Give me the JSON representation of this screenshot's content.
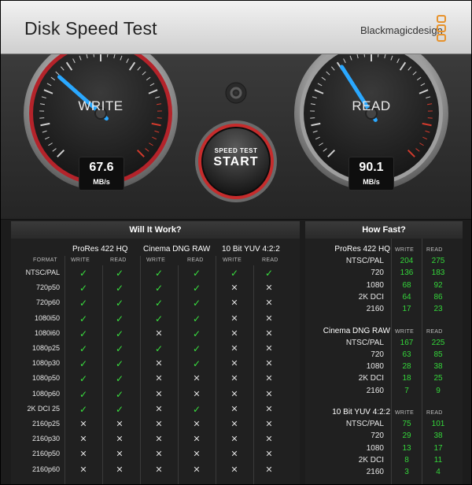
{
  "app": {
    "title": "Disk Speed Test",
    "brand": "Blackmagicdesign",
    "brand_color": "#e7922b"
  },
  "gauges": {
    "write": {
      "label": "WRITE",
      "value": "67.6",
      "unit": "MB/s",
      "needle_fraction": 0.32
    },
    "read": {
      "label": "READ",
      "value": "90.1",
      "unit": "MB/s",
      "needle_fraction": 0.38
    },
    "start_button": {
      "top": "SPEED TEST",
      "main": "START"
    },
    "settings_icon": "gear-icon",
    "needle_color": "#2aa8ff",
    "ring_color": "#c0282a"
  },
  "will_it_work": {
    "title": "Will It Work?",
    "groups": [
      "ProRes 422 HQ",
      "Cinema DNG RAW",
      "10 Bit YUV 4:2:2"
    ],
    "subheads": [
      "FORMAT",
      "WRITE",
      "READ"
    ],
    "rows": [
      {
        "format": "NTSC/PAL",
        "marks": [
          true,
          true,
          true,
          true,
          true,
          true
        ]
      },
      {
        "format": "720p50",
        "marks": [
          true,
          true,
          true,
          true,
          false,
          false
        ]
      },
      {
        "format": "720p60",
        "marks": [
          true,
          true,
          true,
          true,
          false,
          false
        ]
      },
      {
        "format": "1080i50",
        "marks": [
          true,
          true,
          true,
          true,
          false,
          false
        ]
      },
      {
        "format": "1080i60",
        "marks": [
          true,
          true,
          false,
          true,
          false,
          false
        ]
      },
      {
        "format": "1080p25",
        "marks": [
          true,
          true,
          true,
          true,
          false,
          false
        ]
      },
      {
        "format": "1080p30",
        "marks": [
          true,
          true,
          false,
          true,
          false,
          false
        ]
      },
      {
        "format": "1080p50",
        "marks": [
          true,
          true,
          false,
          false,
          false,
          false
        ]
      },
      {
        "format": "1080p60",
        "marks": [
          true,
          true,
          false,
          false,
          false,
          false
        ]
      },
      {
        "format": "2K DCI 25",
        "marks": [
          true,
          true,
          false,
          true,
          false,
          false
        ]
      },
      {
        "format": "2160p25",
        "marks": [
          false,
          false,
          false,
          false,
          false,
          false
        ]
      },
      {
        "format": "2160p30",
        "marks": [
          false,
          false,
          false,
          false,
          false,
          false
        ]
      },
      {
        "format": "2160p50",
        "marks": [
          false,
          false,
          false,
          false,
          false,
          false
        ]
      },
      {
        "format": "2160p60",
        "marks": [
          false,
          false,
          false,
          false,
          false,
          false
        ]
      }
    ],
    "check_color": "#39e03f",
    "cross_color": "#dddddd"
  },
  "how_fast": {
    "title": "How Fast?",
    "subheads": [
      "WRITE",
      "READ"
    ],
    "sections": [
      {
        "name": "ProRes 422 HQ",
        "rows": [
          {
            "format": "NTSC/PAL",
            "write": "204",
            "read": "275"
          },
          {
            "format": "720",
            "write": "136",
            "read": "183"
          },
          {
            "format": "1080",
            "write": "68",
            "read": "92"
          },
          {
            "format": "2K DCI",
            "write": "64",
            "read": "86"
          },
          {
            "format": "2160",
            "write": "17",
            "read": "23"
          }
        ]
      },
      {
        "name": "Cinema DNG RAW",
        "rows": [
          {
            "format": "NTSC/PAL",
            "write": "167",
            "read": "225"
          },
          {
            "format": "720",
            "write": "63",
            "read": "85"
          },
          {
            "format": "1080",
            "write": "28",
            "read": "38"
          },
          {
            "format": "2K DCI",
            "write": "18",
            "read": "25"
          },
          {
            "format": "2160",
            "write": "7",
            "read": "9"
          }
        ]
      },
      {
        "name": "10 Bit YUV 4:2:2",
        "rows": [
          {
            "format": "NTSC/PAL",
            "write": "75",
            "read": "101"
          },
          {
            "format": "720",
            "write": "29",
            "read": "38"
          },
          {
            "format": "1080",
            "write": "13",
            "read": "17"
          },
          {
            "format": "2K DCI",
            "write": "8",
            "read": "11"
          },
          {
            "format": "2160",
            "write": "3",
            "read": "4"
          }
        ]
      }
    ],
    "value_color": "#34d63a"
  }
}
